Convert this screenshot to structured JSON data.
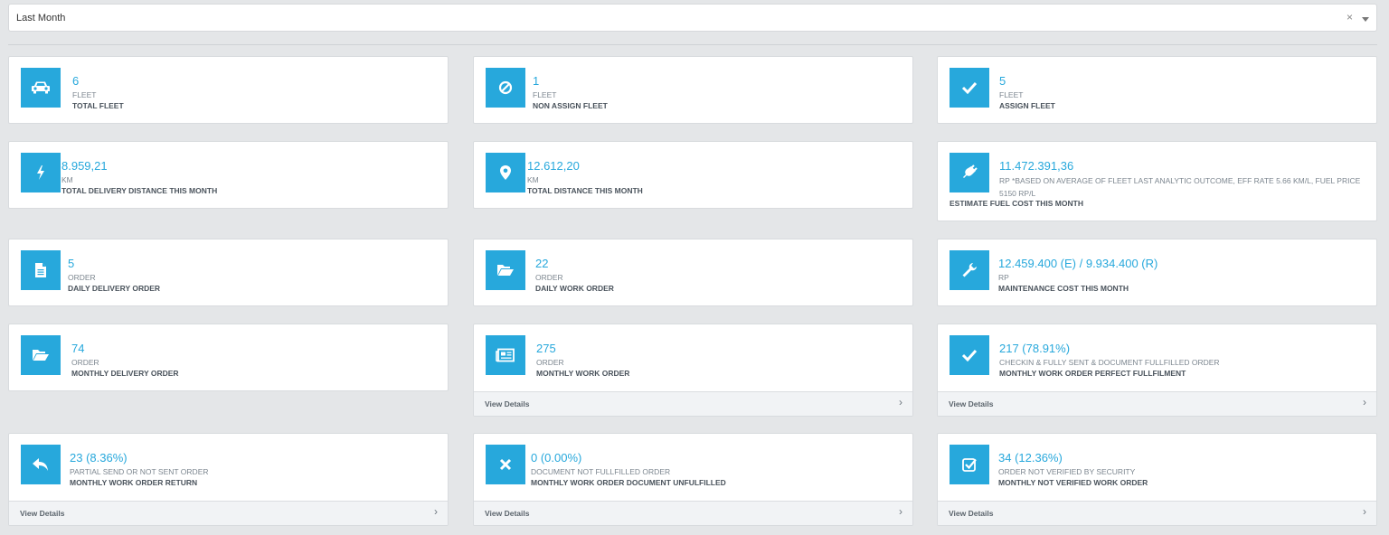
{
  "filter": {
    "value": "Last Month",
    "clear": "×"
  },
  "cards": [
    {
      "icon": "car-icon",
      "value": "6",
      "unit": "FLEET",
      "title": "TOTAL FLEET"
    },
    {
      "icon": "ban-icon",
      "value": "1",
      "unit": "FLEET",
      "title": "NON ASSIGN FLEET"
    },
    {
      "icon": "check-icon",
      "value": "5",
      "unit": "FLEET",
      "title": "ASSIGN FLEET"
    },
    {
      "icon": "bolt-icon",
      "value": "8.959,21",
      "unit": "KM",
      "title": "TOTAL DELIVERY DISTANCE THIS MONTH"
    },
    {
      "icon": "map-pin-icon",
      "value": "12.612,20",
      "unit": "KM",
      "title": "TOTAL DISTANCE THIS MONTH"
    },
    {
      "icon": "plug-icon",
      "value": "11.472.391,36",
      "unit": "RP *BASED ON AVERAGE OF FLEET LAST ANALYTIC OUTCOME, EFF RATE 5.66 KM/L, FUEL PRICE 5150 RP/L",
      "title": "ESTIMATE FUEL COST THIS MONTH"
    },
    {
      "icon": "document-icon",
      "value": "5",
      "unit": "ORDER",
      "title": "DAILY DELIVERY ORDER"
    },
    {
      "icon": "folder-open-icon",
      "value": "22",
      "unit": "ORDER",
      "title": "DAILY WORK ORDER"
    },
    {
      "icon": "wrench-icon",
      "value": "12.459.400 (E) / 9.934.400 (R)",
      "unit": "RP",
      "title": "MAINTENANCE COST THIS MONTH"
    },
    {
      "icon": "folder-open-icon",
      "value": "74",
      "unit": "ORDER",
      "title": "MONTHLY DELIVERY ORDER"
    },
    {
      "icon": "newspaper-icon",
      "value": "275",
      "unit": "ORDER",
      "title": "MONTHLY WORK ORDER",
      "footer": "View Details"
    },
    {
      "icon": "check-icon",
      "value": "217 (78.91%)",
      "unit": "CHECKIN & FULLY SENT & DOCUMENT FULLFILLED ORDER",
      "title": "MONTHLY WORK ORDER PERFECT FULLFILMENT",
      "footer": "View Details"
    },
    {
      "icon": "reply-icon",
      "value": "23 (8.36%)",
      "unit": "PARTIAL SEND OR NOT SENT ORDER",
      "title": "MONTHLY WORK ORDER RETURN",
      "footer": "View Details"
    },
    {
      "icon": "close-icon",
      "value": "0 (0.00%)",
      "unit": "DOCUMENT NOT FULLFILLED ORDER",
      "title": "MONTHLY WORK ORDER DOCUMENT UNFULFILLED",
      "footer": "View Details"
    },
    {
      "icon": "check-square-icon",
      "value": "34 (12.36%)",
      "unit": "ORDER NOT VERIFIED BY SECURITY",
      "title": "MONTHLY NOT VERIFIED WORK ORDER",
      "footer": "View Details"
    }
  ],
  "footer_chevron": "›"
}
